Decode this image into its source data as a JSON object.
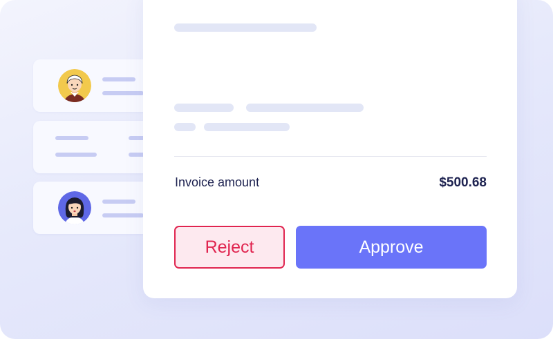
{
  "invoice": {
    "amount_label": "Invoice amount",
    "amount_value": "$500.68"
  },
  "actions": {
    "reject_label": "Reject",
    "approve_label": "Approve"
  },
  "colors": {
    "accent": "#6a74f9",
    "danger": "#e0244f",
    "danger_bg": "#fde9ef",
    "text_dark": "#1d2250",
    "placeholder": "#e2e6f6"
  },
  "avatars": [
    {
      "icon": "user-avatar-man-icon"
    },
    {
      "icon": "user-avatar-woman-icon"
    }
  ]
}
